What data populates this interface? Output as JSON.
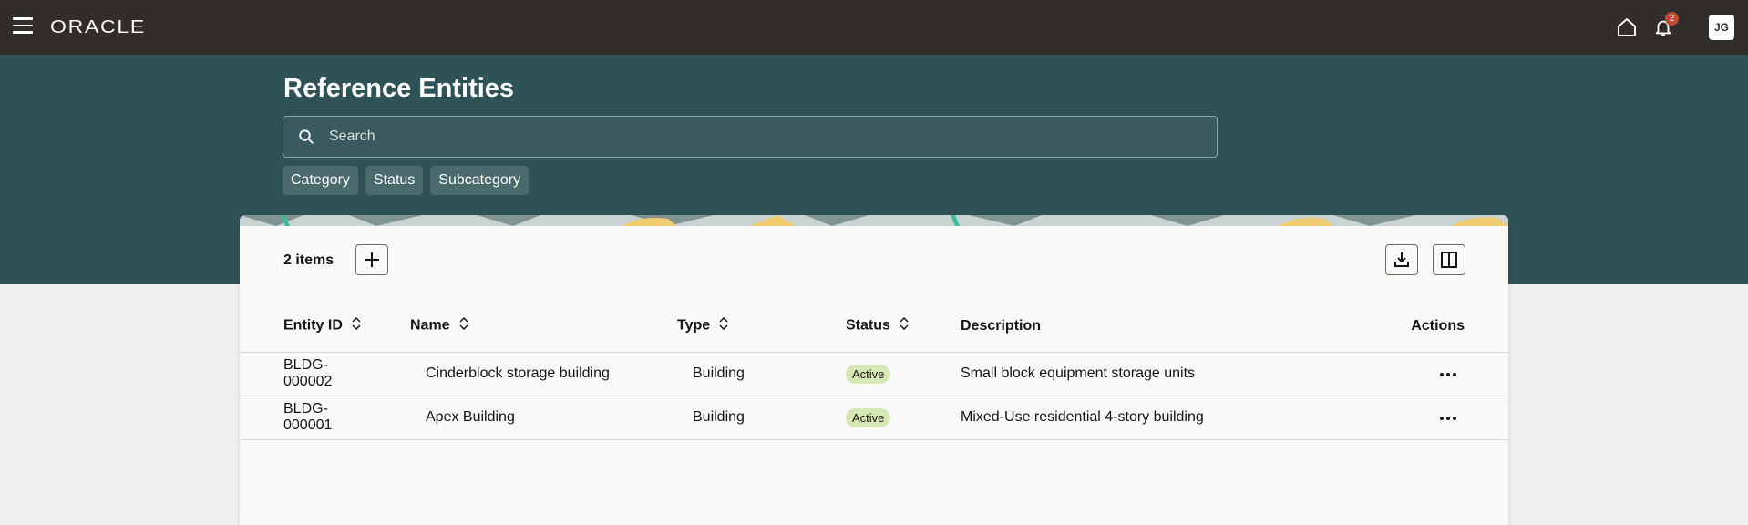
{
  "app": {
    "logo": "ORACLE",
    "notification_count": "2",
    "user_initials": "JG"
  },
  "page": {
    "title": "Reference Entities"
  },
  "search": {
    "placeholder": "Search"
  },
  "filters": [
    "Category",
    "Status",
    "Subcategory"
  ],
  "toolbar": {
    "item_count": "2 items"
  },
  "table": {
    "columns": [
      "Entity ID",
      "Name",
      "Type",
      "Status",
      "Description",
      "Actions"
    ],
    "rows": [
      {
        "entity_id": "BLDG-000002",
        "name": "Cinderblock storage building",
        "type": "Building",
        "status": "Active",
        "description": "Small block equipment storage units"
      },
      {
        "entity_id": "BLDG-000001",
        "name": "Apex Building",
        "type": "Building",
        "status": "Active",
        "description": "Mixed-Use residential 4-story building"
      }
    ]
  },
  "colors": {
    "topbar": "#312d2a",
    "hero": "#2f5257",
    "badge": "#c74634",
    "status_active": "#d4e7b5"
  },
  "icons": [
    "menu-icon",
    "home-icon",
    "bell-icon",
    "search-icon",
    "plus-icon",
    "download-icon",
    "columns-icon",
    "sort-icon",
    "more-icon"
  ]
}
